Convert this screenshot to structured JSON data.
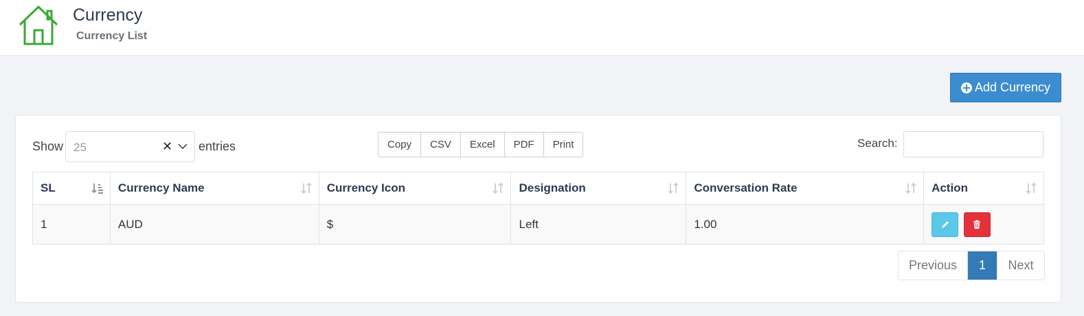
{
  "header": {
    "title": "Currency",
    "subtitle": "Currency List"
  },
  "toolbar": {
    "add_label": "Add Currency"
  },
  "length": {
    "show": "Show",
    "value": "25",
    "entries": "entries"
  },
  "export_buttons": [
    "Copy",
    "CSV",
    "Excel",
    "PDF",
    "Print"
  ],
  "search": {
    "label": "Search:",
    "value": ""
  },
  "table": {
    "columns": [
      "SL",
      "Currency Name",
      "Currency Icon",
      "Designation",
      "Conversation Rate",
      "Action"
    ],
    "rows": [
      {
        "sl": "1",
        "name": "AUD",
        "icon": "$",
        "designation": "Left",
        "rate": "1.00"
      }
    ]
  },
  "pagination": {
    "previous": "Previous",
    "current": "1",
    "next": "Next"
  },
  "colors": {
    "home_icon": "#3aa935",
    "primary": "#3c8dd0",
    "edit": "#5bc8ea",
    "delete": "#e3323c",
    "page_active": "#337ab7"
  },
  "icons": {
    "home": "home-icon",
    "add": "plus-circle-icon",
    "edit": "pencil-icon",
    "delete": "trash-icon",
    "sort": "sort-icon"
  }
}
